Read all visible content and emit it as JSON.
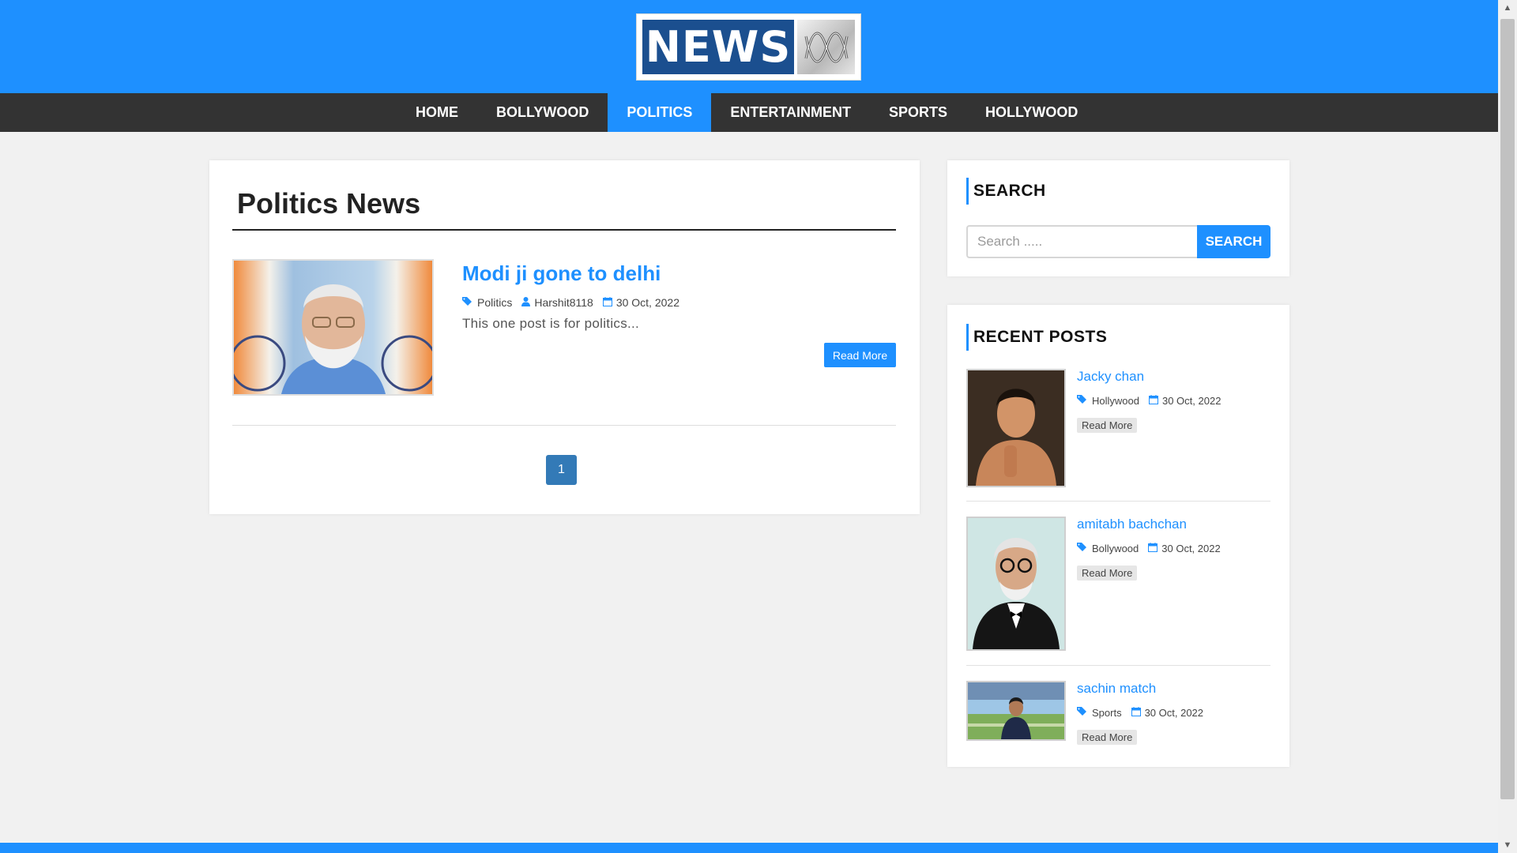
{
  "header": {
    "logo_text": "NEWS",
    "logo_mark": "abc-lissajous-logo"
  },
  "nav": {
    "items": [
      {
        "label": "HOME",
        "active": false
      },
      {
        "label": "BOLLYWOOD",
        "active": false
      },
      {
        "label": "POLITICS",
        "active": true
      },
      {
        "label": "ENTERTAINMENT",
        "active": false
      },
      {
        "label": "SPORTS",
        "active": false
      },
      {
        "label": "HOLLYWOOD",
        "active": false
      }
    ]
  },
  "main": {
    "page_title": "Politics News",
    "post": {
      "title": "Modi ji gone to delhi",
      "category": "Politics",
      "author": "Harshit8118",
      "date": "30 Oct, 2022",
      "excerpt": "This one post is for politics...",
      "read_more": "Read More",
      "category_icon": "tags-icon",
      "author_icon": "user-icon",
      "date_icon": "calendar-icon"
    },
    "pagination": {
      "current": "1"
    }
  },
  "sidebar": {
    "search": {
      "heading": "SEARCH",
      "placeholder": "Search .....",
      "button": "SEARCH"
    },
    "recent": {
      "heading": "RECENT POSTS",
      "posts": [
        {
          "title": "Jacky chan",
          "category": "Hollywood",
          "date": "30 Oct, 2022",
          "read_more": "Read More"
        },
        {
          "title": "amitabh bachchan",
          "category": "Bollywood",
          "date": "30 Oct, 2022",
          "read_more": "Read More"
        },
        {
          "title": "sachin match",
          "category": "Sports",
          "date": "30 Oct, 2022",
          "read_more": "Read More"
        }
      ]
    }
  },
  "colors": {
    "brand_blue": "#1e90ff",
    "nav_dark": "#333333",
    "logo_navy": "#1b4f8f",
    "page_bg": "#f1f1f1",
    "pagination_blue": "#337ab7"
  }
}
